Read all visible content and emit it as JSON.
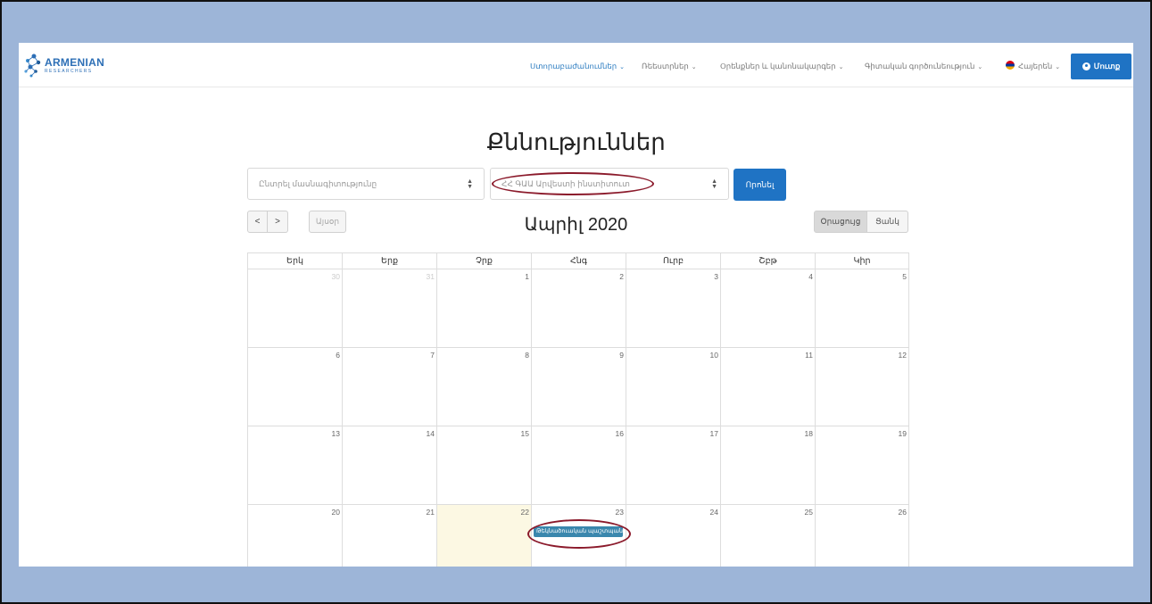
{
  "logo": {
    "main": "ARMENIAN",
    "sub": "RESEARCHERS"
  },
  "nav": {
    "items": [
      {
        "label": "Ստորաբաժանումներ"
      },
      {
        "label": "Ռեեստրներ"
      },
      {
        "label": "Օրենքներ և կանոնակարգեր"
      },
      {
        "label": "Գիտական գործունեություն"
      },
      {
        "label": "Հայերեն"
      }
    ],
    "login_label": "Մուտք"
  },
  "page_title": "Քննություններ",
  "filters": {
    "specialty_placeholder": "Ընտրել մասնագիտությունը",
    "institution_value": "ՀՀ ԳԱԱ Արվեստի ինստիտուտ",
    "filter_button": "Որոնել"
  },
  "toolbar": {
    "prev": "<",
    "next": ">",
    "today": "Այսօր",
    "month_title": "Ապրիլ 2020",
    "view_month": "Օրացույց",
    "view_list": "Ցանկ"
  },
  "calendar": {
    "weekdays": [
      "Երկ",
      "Երք",
      "Չրք",
      "Հնգ",
      "Ուրբ",
      "Շբթ",
      "Կիր"
    ],
    "weeks": [
      [
        "30",
        "31",
        "1",
        "2",
        "3",
        "4",
        "5"
      ],
      [
        "6",
        "7",
        "8",
        "9",
        "10",
        "11",
        "12"
      ],
      [
        "13",
        "14",
        "15",
        "16",
        "17",
        "18",
        "19"
      ],
      [
        "20",
        "21",
        "22",
        "23",
        "24",
        "25",
        "26"
      ]
    ],
    "event_label": "Թեկնածուական պաշտպանություն"
  },
  "colors": {
    "accent": "#1f73c4",
    "event": "#3a87ad",
    "today_bg": "#fcf8e3",
    "annotation": "#8b1a2b",
    "backdrop": "#9db5d8"
  }
}
